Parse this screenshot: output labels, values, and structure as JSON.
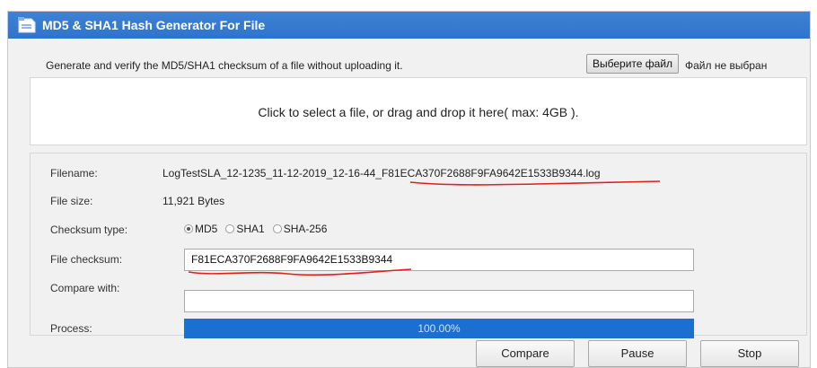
{
  "window": {
    "title": "MD5 & SHA1 Hash Generator For File",
    "title_bar_color": "#2f73cc"
  },
  "top": {
    "description": "Generate and verify the MD5/SHA1 checksum of a file without uploading it.",
    "choose_file_label": "Выберите файл",
    "file_status": "Файл не выбран"
  },
  "dropzone": {
    "text": "Click to select a file, or drag and drop it here( max: 4GB )."
  },
  "details": {
    "filename_label": "Filename:",
    "filename_value": "LogTestSLA_12-1235_11-12-2019_12-16-44_F81ECA370F2688F9FA9642E1533B9344.log",
    "filesize_label": "File size:",
    "filesize_value": "11,921 Bytes",
    "checksum_type_label": "Checksum type:",
    "checksum_options": [
      "MD5",
      "SHA1",
      "SHA-256"
    ],
    "checksum_selected": "MD5",
    "file_checksum_label": "File checksum:",
    "file_checksum_value": "F81ECA370F2688F9FA9642E1533B9344",
    "compare_label": "Compare with:",
    "compare_value": "",
    "process_label": "Process:",
    "process_percent_text": "100.00%",
    "process_fraction": 1.0,
    "progress_color": "#1a6fd1"
  },
  "buttons": {
    "compare": "Compare",
    "pause": "Pause",
    "stop": "Stop"
  },
  "annotations": {
    "underline_color": "#e0201a"
  }
}
